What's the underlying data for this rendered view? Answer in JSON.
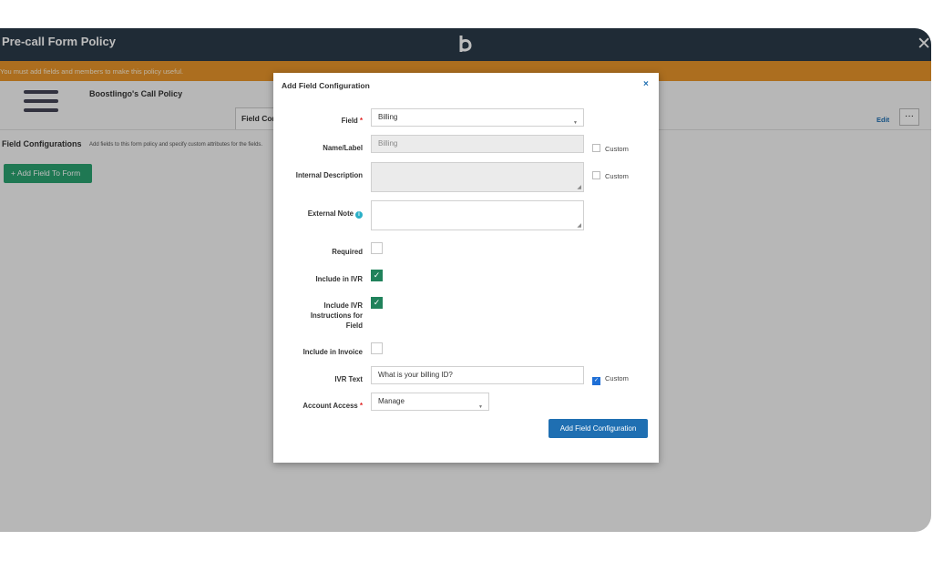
{
  "header": {
    "title": "Pre-call Form Policy",
    "logo_icon": "boostlingo-b-icon",
    "close_icon": "close-icon",
    "close_glyph": "✕"
  },
  "warning": {
    "text": "You must add fields and members to make this policy useful."
  },
  "policy": {
    "name": "Boostlingo's Call Policy",
    "tab_label": "Field Configurations",
    "edit_label": "Edit",
    "more_label": "···"
  },
  "field_configurations": {
    "title": "Field Configurations",
    "description": "Add fields to this form policy and specify custom attributes for the fields.",
    "add_button": "+ Add Field To Form"
  },
  "modal": {
    "title": "Add Field Configuration",
    "close_glyph": "×",
    "required_mark": "*",
    "fields": {
      "field": {
        "label": "Field",
        "value": "Billing"
      },
      "name_label": {
        "label": "Name/Label",
        "value": "Billing"
      },
      "internal_description": {
        "label": "Internal Description",
        "value": ""
      },
      "external_note": {
        "label": "External Note",
        "value": "",
        "info_glyph": "i"
      },
      "required": {
        "label": "Required",
        "checked": false
      },
      "include_ivr": {
        "label": "Include in IVR",
        "checked": true
      },
      "include_ivr_instructions": {
        "label_line1": "Include IVR",
        "label_line2": "Instructions for",
        "label_line3": "Field",
        "checked": true
      },
      "include_invoice": {
        "label": "Include in Invoice",
        "checked": false
      },
      "ivr_text": {
        "label": "IVR Text",
        "value": "What is your billing ID?"
      },
      "account_access": {
        "label": "Account Access",
        "value": "Manage"
      }
    },
    "custom_label": "Custom",
    "check_glyph": "✓",
    "caret_glyph": "▼",
    "submit": "Add Field Configuration"
  },
  "colors": {
    "header_bg": "#2b3a4a",
    "warning_bg": "#e8952a",
    "primary": "#1f6fb2",
    "success": "#2aa371",
    "checkbox_on": "#20825b"
  }
}
